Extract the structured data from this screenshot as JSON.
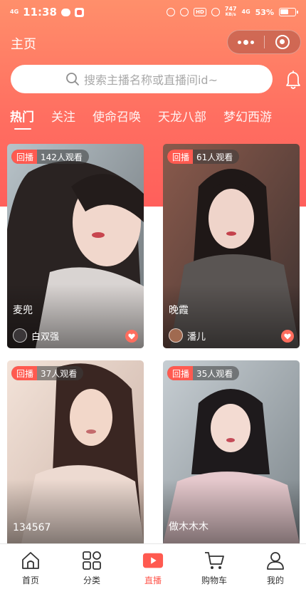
{
  "status_bar": {
    "network": "4G",
    "time": "11:38",
    "hd_label": "HD",
    "speed": "747",
    "speed_unit": "KB/s",
    "network2": "4G",
    "battery": "53%"
  },
  "header": {
    "title": "主页"
  },
  "search": {
    "placeholder": "搜索主播名称或直播间id~"
  },
  "tabs": [
    {
      "label": "热门",
      "active": true
    },
    {
      "label": "关注",
      "active": false
    },
    {
      "label": "使命召唤",
      "active": false
    },
    {
      "label": "天龙八部",
      "active": false
    },
    {
      "label": "梦幻西游",
      "active": false
    }
  ],
  "cards": [
    {
      "replay_label": "回播",
      "viewers": "142人观看",
      "name": "麦兜",
      "host": "白双强"
    },
    {
      "replay_label": "回播",
      "viewers": "61人观看",
      "name": "晚霞",
      "host": "潘儿"
    },
    {
      "replay_label": "回播",
      "viewers": "37人观看",
      "name": "134567",
      "host": ""
    },
    {
      "replay_label": "回播",
      "viewers": "35人观看",
      "name": "做木木木",
      "host": ""
    }
  ],
  "bottom_nav": [
    {
      "label": "首页",
      "icon": "home-icon",
      "active": false
    },
    {
      "label": "分类",
      "icon": "grid-icon",
      "active": false
    },
    {
      "label": "直播",
      "icon": "live-video-icon",
      "active": true
    },
    {
      "label": "购物车",
      "icon": "cart-icon",
      "active": false
    },
    {
      "label": "我的",
      "icon": "user-icon",
      "active": false
    }
  ],
  "colors": {
    "accent": "#ff5a50",
    "header_gradient_top": "#ff8f6b",
    "header_gradient_bottom": "#ff5f5b"
  }
}
